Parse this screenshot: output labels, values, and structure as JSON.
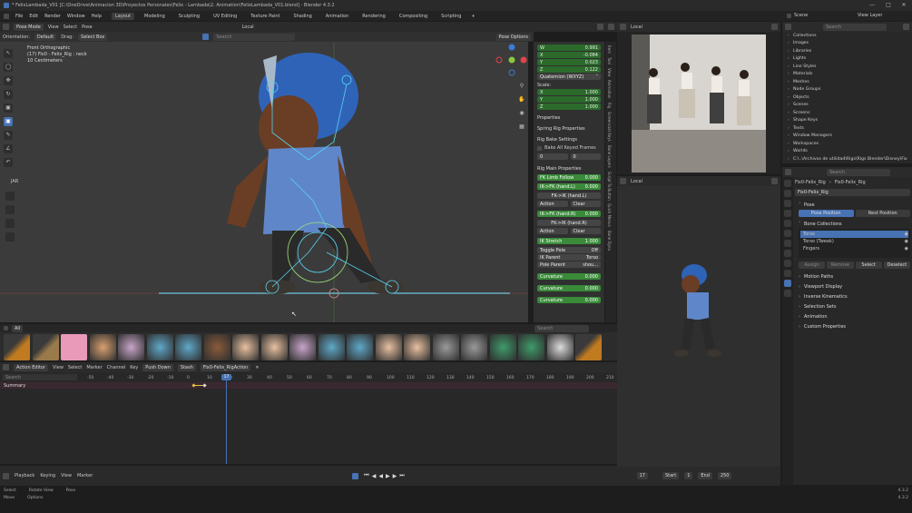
{
  "titlebar": {
    "title": "* FelixLambada_V01 [C:\\OneDrive\\Animacion 3D\\Proyectos Personales\\Felix - Lambada\\2. Animation\\FelixLambada_V01.blend] - Blender 4.3.2"
  },
  "menubar": {
    "menus": [
      "File",
      "Edit",
      "Render",
      "Window",
      "Help"
    ],
    "workspaces": [
      "Layout",
      "Modeling",
      "Sculpting",
      "UV Editing",
      "Texture Paint",
      "Shading",
      "Animation",
      "Rendering",
      "Compositing",
      "Scripting"
    ],
    "active_workspace": "Layout",
    "scene_label": "Scene",
    "view_layer_label": "View Layer"
  },
  "viewport": {
    "mode": "Pose Mode",
    "menus": [
      "View",
      "Select",
      "Pose"
    ],
    "orientation_label": "Orientation:",
    "orientation_value": "Default",
    "drag_label": "Drag:",
    "drag_value": "Select Box",
    "transform_space": "Local",
    "pose_options": "Pose Options",
    "info_line1": "Front Orthographic",
    "info_line2": "(17) Fix0 - Felix_Rig : neck",
    "info_line3": "10 Centimeters",
    "jar_label": "JAR",
    "search_placeholder": "Search"
  },
  "npanel": {
    "w": {
      "label": "W",
      "value": "0.991"
    },
    "x": {
      "label": "X",
      "value": "-0.084"
    },
    "y": {
      "label": "Y",
      "value": "0.023"
    },
    "z": {
      "label": "Z",
      "value": "0.122"
    },
    "rotation_mode": "Quaternion (WXYZ)",
    "scale_label": "Scale:",
    "scale": [
      {
        "label": "X",
        "value": "1.000"
      },
      {
        "label": "Y",
        "value": "1.000"
      },
      {
        "label": "Z",
        "value": "1.000"
      }
    ],
    "sections": [
      "Properties",
      "Spring Rig Properties",
      "Rig Bake Settings"
    ],
    "bake_all": "Bake All Keyed Frames",
    "bake_start": "0",
    "bake_end": "0",
    "rig_main": "Rig Main Properties",
    "fk_limb_follow": {
      "label": "FK Limb Follow",
      "value": "0.000"
    },
    "ik_fk_hand_l": {
      "label": "IK->FK (hand.L)",
      "value": "0.000"
    },
    "fk_ik_hand_l": "FK->IK (hand.L)",
    "action_label": "Action",
    "clear_label": "Clear",
    "ik_fk_hand_r": {
      "label": "IK->FK (hand.R)",
      "value": "0.000"
    },
    "fk_ik_hand_r": "FK->IK (hand.R)",
    "ik_stretch": {
      "label": "IK Stretch",
      "value": "1.000"
    },
    "toggle_pole": {
      "label": "Toggle Pole",
      "value": "Off"
    },
    "ik_parent": {
      "label": "IK Parent",
      "value": "Torso"
    },
    "pole_parent": {
      "label": "Pole Parent",
      "value": "shou..."
    },
    "curvature_label": "Curvature",
    "curvature_values": [
      "0.000",
      "0.000",
      "0.000"
    ],
    "vtabs": [
      "Item",
      "Tool",
      "View",
      "Animation",
      "Rig",
      "Screencast Keys",
      "Bone Layers",
      "Script To Button",
      "Quick Menus",
      "Bone Dyna"
    ]
  },
  "asset_browser": {
    "label": "All",
    "search_placeholder": "Search"
  },
  "action_editor": {
    "mode": "Action Editor",
    "menus": [
      "View",
      "Select",
      "Marker",
      "Channel",
      "Key"
    ],
    "push_down": "Push Down",
    "stash": "Stash",
    "action_name": "Fix0-Felix_RigAction",
    "summary": "Summary",
    "ticks": [
      "-50",
      "-40",
      "-30",
      "-20",
      "-10",
      "0",
      "10",
      "20",
      "30",
      "40",
      "50",
      "60",
      "70",
      "80",
      "90",
      "100",
      "110",
      "120",
      "130",
      "140",
      "150",
      "160",
      "170",
      "180",
      "190",
      "200",
      "210"
    ],
    "current_frame": "17",
    "search_placeholder": "Search"
  },
  "timeline": {
    "menus": [
      "Playback",
      "Keying",
      "View",
      "Marker"
    ],
    "frame": "17",
    "start_label": "Start",
    "start": "1",
    "end_label": "End",
    "end": "250"
  },
  "status": {
    "row1": [
      "Select",
      "Rotate View",
      "Pose"
    ],
    "row2": [
      "Move",
      "Options"
    ],
    "version_top": "4.3.2",
    "version_bottom": "4.3.2"
  },
  "right_viewport": {
    "transform_space": "Local"
  },
  "outliner": {
    "search_placeholder": "Search",
    "items": [
      {
        "label": "Collections"
      },
      {
        "label": "Images"
      },
      {
        "label": "Libraries"
      },
      {
        "label": "Lights"
      },
      {
        "label": "Line Styles"
      },
      {
        "label": "Materials"
      },
      {
        "label": "Meshes"
      },
      {
        "label": "Node Groups"
      },
      {
        "label": "Objects"
      },
      {
        "label": "Scenes"
      },
      {
        "label": "Screens"
      },
      {
        "label": "Shape Keys"
      },
      {
        "label": "Texts"
      },
      {
        "label": "Window Managers"
      },
      {
        "label": "Workspaces"
      },
      {
        "label": "Worlds"
      },
      {
        "label": "C:\\..\\Archivos de utilidad\\Rigs\\Rigs Blender\\Disney\\Fix"
      }
    ]
  },
  "properties": {
    "search_placeholder": "Search",
    "breadcrumb": [
      "Fix0-Felix_Rig",
      "Fix0-Felix_Rig"
    ],
    "datablock": "Fix0-Felix_Rig",
    "pose_section": "Pose",
    "pose_position": "Pose Position",
    "rest_position": "Rest Position",
    "bone_collections": "Bone Collections",
    "collections": [
      {
        "label": "Torso"
      },
      {
        "label": "Torso (Tweak)"
      },
      {
        "label": "Fingers"
      }
    ],
    "assign": "Assign",
    "remove": "Remove",
    "select": "Select",
    "deselect": "Deselect",
    "sections": [
      "Motion Paths",
      "Viewport Display",
      "Inverse Kinematics",
      "Selection Sets",
      "Animation",
      "Custom Properties"
    ]
  }
}
